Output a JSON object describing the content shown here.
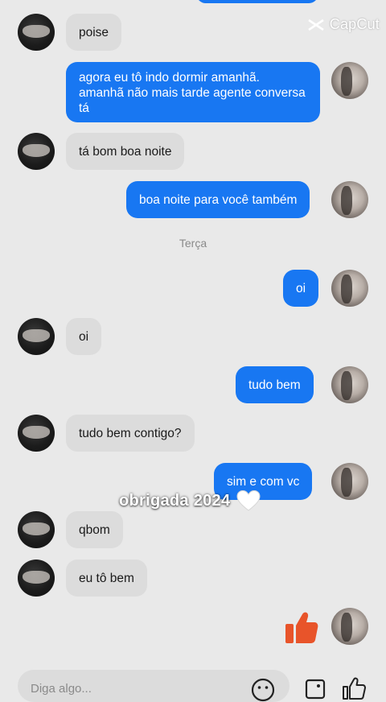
{
  "watermark": {
    "label": "CapCut"
  },
  "conversation": {
    "day_separator": "Terça",
    "messages": [
      {
        "side": "in",
        "text": "poise"
      },
      {
        "side": "out",
        "text": "agora eu tô indo dormir amanhã. amanhã não mais tarde agente conversa tá"
      },
      {
        "side": "in",
        "text": "tá bom boa noite"
      },
      {
        "side": "out",
        "text": "boa noite para você também"
      },
      {
        "side": "out",
        "text": "oi"
      },
      {
        "side": "in",
        "text": "oi"
      },
      {
        "side": "out",
        "text": "tudo bem"
      },
      {
        "side": "in",
        "text": "tudo bem contigo?"
      },
      {
        "side": "out",
        "text": "sim e com vc"
      },
      {
        "side": "in",
        "text": "qbom"
      },
      {
        "side": "in",
        "text": "eu tô bem"
      }
    ],
    "sticker": "thumbs-up-sticker"
  },
  "overlay": {
    "caption": "obrigada 2024"
  },
  "composer": {
    "placeholder": "Diga algo..."
  },
  "colors": {
    "outgoing": "#1877f2",
    "incoming": "#dcdcdc",
    "background": "#e9e9e9",
    "sticker": "#e8542a"
  }
}
